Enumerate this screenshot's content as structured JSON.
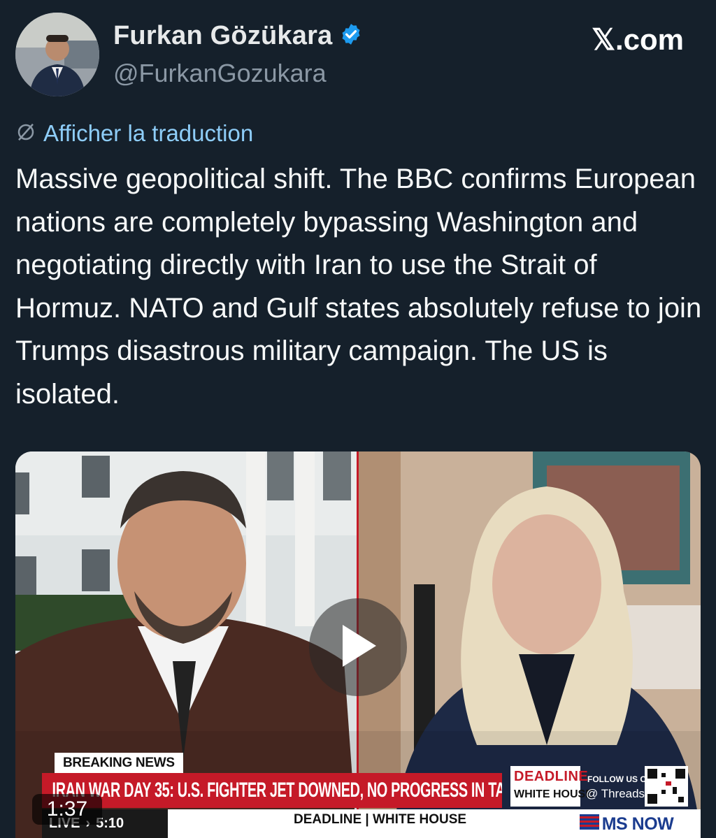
{
  "header": {
    "display_name": "Furkan Gözükara",
    "handle": "@FurkanGozukara",
    "brand": "𝕏.com",
    "verified_icon": "verified-badge-icon"
  },
  "translation": {
    "label": "Afficher la traduction",
    "icon": "translate-globe-icon"
  },
  "tweet": {
    "text": "Massive geopolitical shift. The BBC confirms European nations are completely bypassing Washington and negotiating directly with Iran to use the Strait of Hormuz. NATO and Gulf states absolutely refuse to join Trumps disastrous military campaign. The US is isolated."
  },
  "video": {
    "duration": "1:37",
    "play_icon": "play-icon",
    "breaking_label": "BREAKING NEWS",
    "headline": "IRAN WAR DAY 35: U.S. FIGHTER JET DOWNED, NO PROGRESS IN TALKS",
    "live_label": "LIVE",
    "live_time": "5:10",
    "lower_show": "DEADLINE | WHITE HOUSE",
    "deadline_top": "DEADLINE",
    "deadline_bottom": "WHITE HOUSE",
    "follow_top": "FOLLOW US ON",
    "follow_bottom": "Threads",
    "network_logo": "MS NOW"
  },
  "colors": {
    "background": "#15202b",
    "link": "#8ecdf8",
    "verified": "#1d9bf0",
    "breaking_red": "#c51a28"
  }
}
